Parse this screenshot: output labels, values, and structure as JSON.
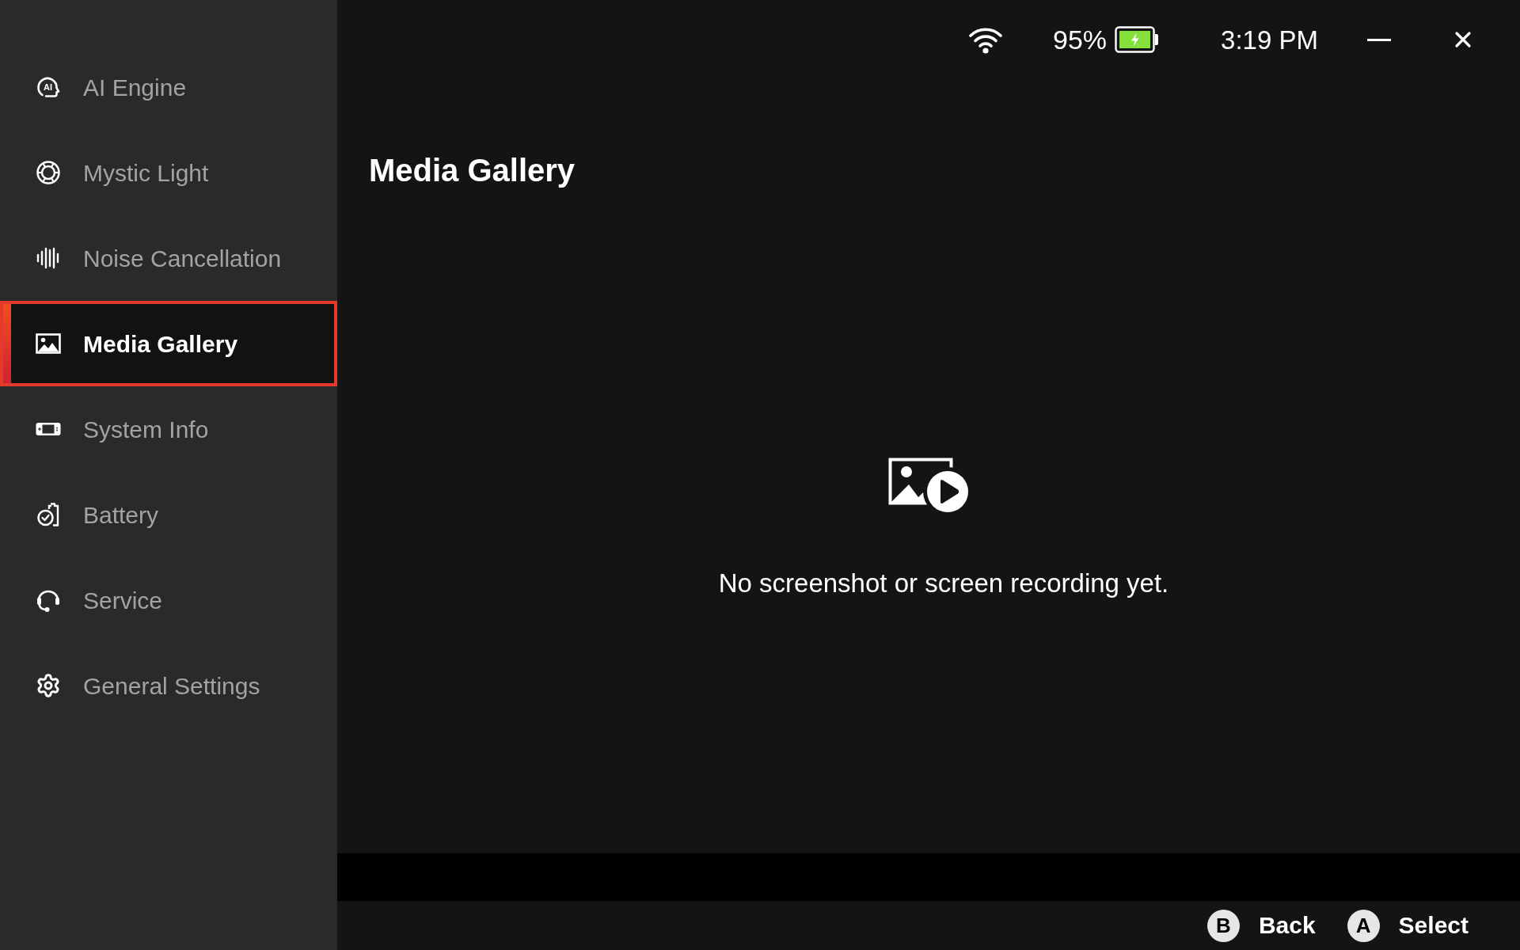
{
  "sidebar": {
    "items": [
      {
        "label": "AI Engine",
        "selected": false,
        "icon_text": "AI"
      },
      {
        "label": "Mystic Light",
        "selected": false
      },
      {
        "label": "Noise Cancellation",
        "selected": false
      },
      {
        "label": "Media Gallery",
        "selected": true
      },
      {
        "label": "System Info",
        "selected": false
      },
      {
        "label": "Battery",
        "selected": false
      },
      {
        "label": "Service",
        "selected": false
      },
      {
        "label": "General Settings",
        "selected": false
      }
    ]
  },
  "status_bar": {
    "battery": "95%",
    "charging": true,
    "time": "3:19 PM"
  },
  "page": {
    "title": "Media Gallery",
    "empty_message": "No screenshot or screen recording yet."
  },
  "footer": {
    "actions": [
      {
        "key": "B",
        "label": "Back"
      },
      {
        "key": "A",
        "label": "Select"
      }
    ]
  }
}
